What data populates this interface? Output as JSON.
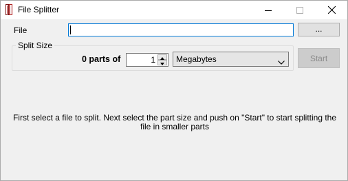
{
  "window": {
    "title": "File Splitter",
    "title_icon": "app-book-icon",
    "controls": [
      "minimize-icon",
      "maximize-icon",
      "close-icon"
    ]
  },
  "file": {
    "label": "File",
    "value": "",
    "browse_label": "..."
  },
  "split": {
    "group_label": "Split Size",
    "parts_label": "0 parts of",
    "spin_value": "1",
    "unit_selected": "Megabytes",
    "start_label": "Start",
    "start_enabled": false
  },
  "message": "First select a file to split. Next select the part size and  push on \"Start\" to start splitting the file in smaller parts",
  "colors": {
    "window_bg": "#f0f0f0",
    "focus_border": "#0078d7",
    "disabled_button_bg": "#cccccc",
    "disabled_text": "#8a8a8a"
  }
}
